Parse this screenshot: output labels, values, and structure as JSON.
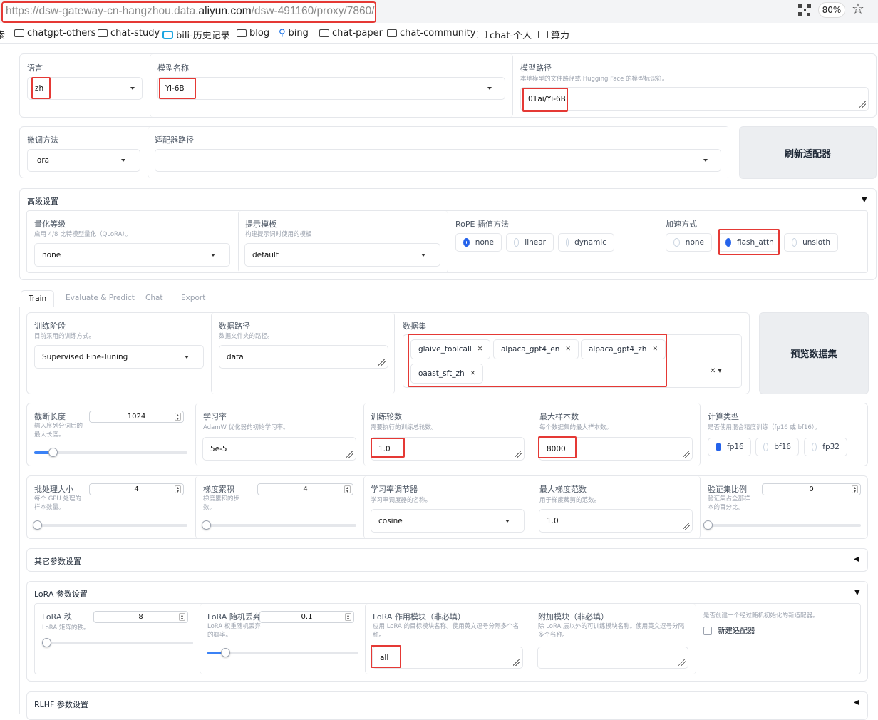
{
  "browser": {
    "url_prefix": "https://dsw-gateway-cn-hangzhou.data.",
    "url_domain": "aliyun.com",
    "url_suffix": "/dsw-491160/proxy/7860/",
    "zoom": "80%",
    "icons": [
      "qr-code-icon",
      "star-icon"
    ],
    "bookmarks": [
      {
        "label": "索",
        "icon": "none"
      },
      {
        "label": "chatgpt-others",
        "icon": "folder-icon"
      },
      {
        "label": "chat-study",
        "icon": "folder-icon"
      },
      {
        "label": "bili-历史记录",
        "icon": "bilibili-icon"
      },
      {
        "label": "blog",
        "icon": "folder-icon"
      },
      {
        "label": "bing",
        "icon": "search-icon"
      },
      {
        "label": "chat-paper",
        "icon": "folder-icon"
      },
      {
        "label": "chat-community",
        "icon": "folder-icon"
      },
      {
        "label": "chat-个人",
        "icon": "folder-icon"
      },
      {
        "label": "算力",
        "icon": "folder-icon"
      }
    ]
  },
  "model": {
    "lang_label": "语言",
    "lang_value": "zh",
    "name_label": "模型名称",
    "name_value": "Yi-6B",
    "path_label": "模型路径",
    "path_hint": "本地模型的文件路径或 Hugging Face 的模型标识符。",
    "path_value": "01ai/Yi-6B"
  },
  "finetune": {
    "method_label": "微调方法",
    "method_value": "lora",
    "adapter_label": "适配器路径",
    "adapter_value": "",
    "refresh_button": "刷新适配器"
  },
  "advanced": {
    "title": "高级设置",
    "quant_label": "量化等级",
    "quant_hint": "启用 4/8 比特模型量化（QLoRA）。",
    "quant_value": "none",
    "template_label": "提示模板",
    "template_hint": "构建提示词时使用的模板",
    "template_value": "default",
    "rope_label": "RoPE 插值方法",
    "rope_options": [
      "none",
      "linear",
      "dynamic"
    ],
    "rope_selected": "none",
    "accel_label": "加速方式",
    "accel_options": [
      "none",
      "flash_attn",
      "unsloth"
    ],
    "accel_selected": "flash_attn"
  },
  "tabs": [
    "Train",
    "Evaluate & Predict",
    "Chat",
    "Export"
  ],
  "active_tab": "Train",
  "train": {
    "stage_label": "训练阶段",
    "stage_hint": "目前采用的训练方式。",
    "stage_value": "Supervised Fine-Tuning",
    "datadir_label": "数据路径",
    "datadir_hint": "数据文件夹的路径。",
    "datadir_value": "data",
    "dataset_label": "数据集",
    "datasets": [
      "glaive_toolcall",
      "alpaca_gpt4_en",
      "alpaca_gpt4_zh",
      "oaast_sft_zh"
    ],
    "preview_button": "预览数据集",
    "cutoff_label": "截断长度",
    "cutoff_hint": "输入序列分词后的最大长度。",
    "cutoff_value": "1024",
    "cutoff_fraction": 0.12,
    "lr_label": "学习率",
    "lr_hint": "AdamW 优化器的初始学习率。",
    "lr_value": "5e-5",
    "epochs_label": "训练轮数",
    "epochs_hint": "需要执行的训练总轮数。",
    "epochs_value": "1.0",
    "maxsamples_label": "最大样本数",
    "maxsamples_hint": "每个数据集的最大样本数。",
    "maxsamples_value": "8000",
    "compute_label": "计算类型",
    "compute_hint": "是否使用混合精度训练（fp16 或 bf16）。",
    "compute_options": [
      "fp16",
      "bf16",
      "fp32"
    ],
    "compute_selected": "fp16",
    "batch_label": "批处理大小",
    "batch_hint": "每个 GPU 处理的样本数量。",
    "batch_value": "4",
    "batch_fraction": 0.02,
    "accum_label": "梯度累积",
    "accum_hint": "梯度累积的步数。",
    "accum_value": "4",
    "accum_fraction": 0.02,
    "sched_label": "学习率调节器",
    "sched_hint": "学习率调度器的名称。",
    "sched_value": "cosine",
    "maxgrad_label": "最大梯度范数",
    "maxgrad_hint": "用于梯度裁剪的范数。",
    "maxgrad_value": "1.0",
    "val_label": "验证集比例",
    "val_hint": "验证集占全部样本的百分比。",
    "val_value": "0",
    "val_fraction": 0.0,
    "other_title": "其它参数设置"
  },
  "lora": {
    "title": "LoRA 参数设置",
    "rank_label": "LoRA 秩",
    "rank_hint": "LoRA 矩阵的秩。",
    "rank_value": "8",
    "rank_fraction": 0.03,
    "dropout_label": "LoRA 随机丢弃",
    "dropout_hint": "LoRA 权重随机丢弃的概率。",
    "dropout_value": "0.1",
    "dropout_fraction": 0.12,
    "target_label": "LoRA 作用模块（非必填）",
    "target_hint": "应用 LoRA 的目标模块名称。使用英文逗号分隔多个名称。",
    "target_value": "all",
    "extra_label": "附加模块（非必填）",
    "extra_hint": "除 LoRA 层以外的可训练模块名称。使用英文逗号分隔多个名称。",
    "extra_value": "",
    "newadapter_hint": "是否创建一个经过随机初始化的新适配器。",
    "newadapter_label": "新建适配器"
  },
  "rlhf": {
    "title": "RLHF 参数设置"
  }
}
